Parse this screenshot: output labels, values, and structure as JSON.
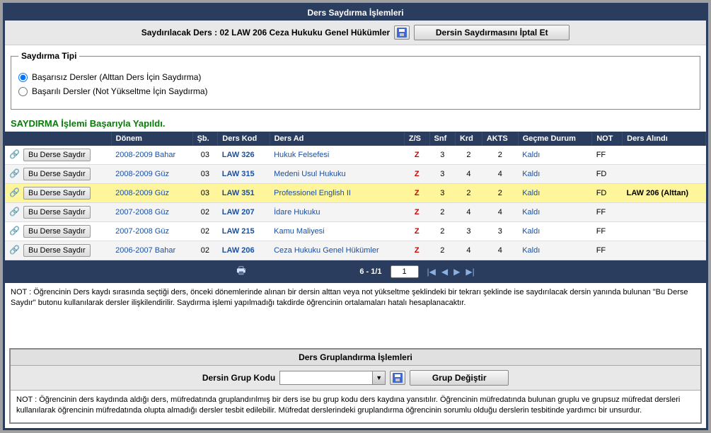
{
  "header": {
    "title": "Ders Saydırma İşlemleri",
    "sub_label": "Saydırılacak Ders : 02 LAW 206 Ceza Hukuku Genel Hükümler",
    "cancel_btn": "Dersin Saydırmasını İptal Et"
  },
  "type_panel": {
    "legend": "Saydırma Tipi",
    "opt_fail": "Başarısız Dersler (Alttan Ders İçin Saydırma)",
    "opt_pass": "Başarılı Dersler (Not Yükseltme İçin Saydırma)"
  },
  "success": "SAYDIRMA İşlemi Başarıyla Yapıldı.",
  "cols": {
    "empty": "",
    "donem": "Dönem",
    "sb": "Şb.",
    "kod": "Ders Kod",
    "ad": "Ders Ad",
    "zs": "Z/S",
    "snf": "Snf",
    "krd": "Krd",
    "akts": "AKTS",
    "gecme": "Geçme Durum",
    "not": "NOT",
    "alindi": "Ders Alındı"
  },
  "row_btn": "Bu Derse Saydır",
  "rows": [
    {
      "donem": "2008-2009 Bahar",
      "sb": "03",
      "kod": "LAW 326",
      "ad": "Hukuk Felsefesi",
      "zs": "Z",
      "snf": "3",
      "krd": "2",
      "akts": "2",
      "gecme": "Kaldı",
      "not": "FF",
      "alindi": "",
      "hl": false
    },
    {
      "donem": "2008-2009 Güz",
      "sb": "03",
      "kod": "LAW 315",
      "ad": "Medeni Usul Hukuku",
      "zs": "Z",
      "snf": "3",
      "krd": "4",
      "akts": "4",
      "gecme": "Kaldı",
      "not": "FD",
      "alindi": "",
      "hl": false
    },
    {
      "donem": "2008-2009 Güz",
      "sb": "03",
      "kod": "LAW 351",
      "ad": "Professionel English II",
      "zs": "Z",
      "snf": "3",
      "krd": "2",
      "akts": "2",
      "gecme": "Kaldı",
      "not": "FD",
      "alindi": "LAW 206 (Alttan)",
      "hl": true
    },
    {
      "donem": "2007-2008 Güz",
      "sb": "02",
      "kod": "LAW 207",
      "ad": "İdare Hukuku",
      "zs": "Z",
      "snf": "2",
      "krd": "4",
      "akts": "4",
      "gecme": "Kaldı",
      "not": "FF",
      "alindi": "",
      "hl": false
    },
    {
      "donem": "2007-2008 Güz",
      "sb": "02",
      "kod": "LAW 215",
      "ad": "Kamu Maliyesi",
      "zs": "Z",
      "snf": "2",
      "krd": "3",
      "akts": "3",
      "gecme": "Kaldı",
      "not": "FF",
      "alindi": "",
      "hl": false
    },
    {
      "donem": "2006-2007 Bahar",
      "sb": "02",
      "kod": "LAW 206",
      "ad": "Ceza Hukuku Genel Hükümler",
      "zs": "Z",
      "snf": "2",
      "krd": "4",
      "akts": "4",
      "gecme": "Kaldı",
      "not": "FF",
      "alindi": "",
      "hl": false
    }
  ],
  "pager": {
    "text": "6 - 1/1",
    "input": "1"
  },
  "note1": "NOT : Öğrencinin Ders kaydı sırasında seçtiği ders, önceki dönemlerinde alınan bir dersin alttan veya not yükseltme şeklindeki bir  tekrarı şeklinde ise saydırılacak dersin yanında bulunan \"Bu Derse Saydır\" butonu kullanılarak dersler ilişkilendirilir. Saydırma işlemi yapılmadığı takdirde öğrencinin ortalamaları hatalı hesaplanacaktır.",
  "group": {
    "header": "Ders Gruplandırma İşlemleri",
    "label": "Dersin Grup Kodu",
    "btn": "Grup Değiştir",
    "note": "NOT : Öğrencinin ders kaydında aldığı ders, müfredatında  gruplandırılmış bir ders ise bu grup kodu ders kaydına yansıtılır. Öğrencinin müfredatında bulunan gruplu ve grupsuz müfredat dersleri  kullanılarak öğrencinin müfredatında olupta almadığı dersler tesbit edilebilir. Müfredat derslerindeki gruplandırma öğrencinin sorumlu olduğu derslerin tesbitinde yardımcı bir unsurdur."
  }
}
